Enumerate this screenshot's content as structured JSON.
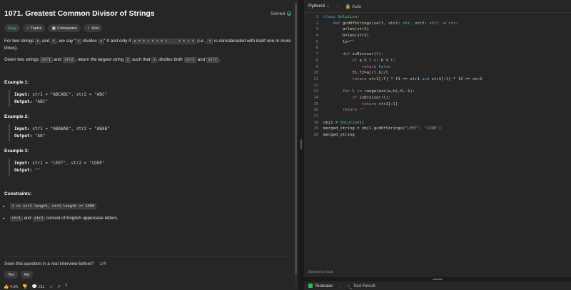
{
  "problem": {
    "title": "1071. Greatest Common Divisor of Strings",
    "status": "Solved",
    "tags": [
      "Easy",
      "Topics",
      "Companies",
      "Hint"
    ],
    "desc1_a": "For two strings ",
    "desc1_s": "s",
    "desc1_b": " and ",
    "desc1_t": "t",
    "desc1_c": ", we say \"",
    "desc1_t2": "t",
    "desc1_d": " divides ",
    "desc1_s2": "s",
    "desc1_e": "\" if and only if ",
    "desc1_expr": "s = t + t + t + ... + t + t",
    "desc1_f": " (i.e., ",
    "desc1_t3": "t",
    "desc1_g": " is concatenated with itself one or more times).",
    "desc2_a": "Given two strings ",
    "desc2_s1": "str1",
    "desc2_b": " and ",
    "desc2_s2": "str2",
    "desc2_c": ", return ",
    "desc2_em1": "the largest string ",
    "desc2_x": "x",
    "desc2_em2": " such that ",
    "desc2_x2": "x",
    "desc2_em3": " divides both ",
    "desc2_s3": "str1",
    "desc2_em4": " and ",
    "desc2_s4": "str2",
    "desc2_d": ".",
    "examples": [
      {
        "title": "Example 1:",
        "input_label": "Input:",
        "input": " str1 = \"ABCABC\", str2 = \"ABC\"",
        "output_label": "Output:",
        "output": " \"ABC\""
      },
      {
        "title": "Example 2:",
        "input_label": "Input:",
        "input": " str1 = \"ABABAB\", str2 = \"ABAB\"",
        "output_label": "Output:",
        "output": " \"AB\""
      },
      {
        "title": "Example 3:",
        "input_label": "Input:",
        "input": " str1 = \"LEET\", str2 = \"CODE\"",
        "output_label": "Output:",
        "output": " \"\""
      }
    ],
    "constraints_title": "Constraints:",
    "constraint1": "1 <= str1.length, str2.length <= 1000",
    "constraint2_s1": "str1",
    "constraint2_a": " and ",
    "constraint2_s2": "str2",
    "constraint2_b": " consist of English uppercase letters."
  },
  "interview": {
    "question": "Seen this question in a real interview before?",
    "count": "1/4",
    "yes": "Yes",
    "no": "No"
  },
  "footer": {
    "likes": "4.8K",
    "comments": "211"
  },
  "editor": {
    "language": "Python3",
    "mode": "Auto",
    "saved": "Saved to local"
  },
  "testbar": {
    "testcase": "Testcase",
    "result": "Test Result"
  }
}
